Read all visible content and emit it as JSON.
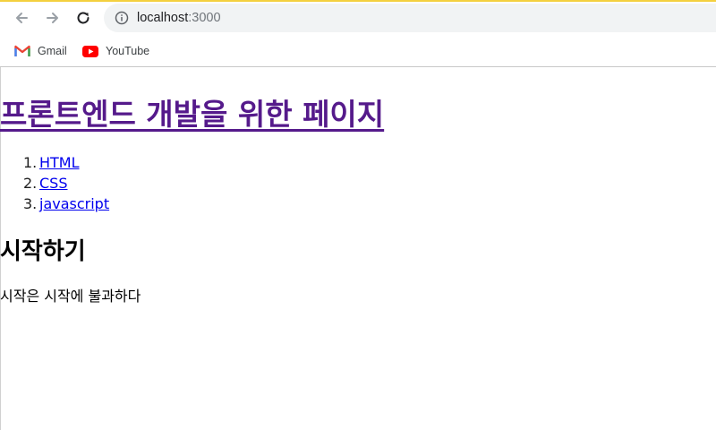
{
  "browser": {
    "url_host": "localhost",
    "url_port": ":3000",
    "bookmarks": [
      {
        "label": "Gmail",
        "icon": "gmail-icon"
      },
      {
        "label": "YouTube",
        "icon": "youtube-icon"
      }
    ],
    "colors": {
      "loading_bar": "#f4d03f",
      "omnibox_bg": "#f1f3f4"
    }
  },
  "page": {
    "title": "프론트엔드 개발을 위한 페이지",
    "list": [
      {
        "num": "1.",
        "label": "HTML"
      },
      {
        "num": "2.",
        "label": "CSS"
      },
      {
        "num": "3.",
        "label": "javascript"
      }
    ],
    "section_heading": "시작하기",
    "section_body": "시작은 시작에 불과하다",
    "colors": {
      "visited_link": "#551a8b",
      "link": "#0000ee"
    }
  }
}
